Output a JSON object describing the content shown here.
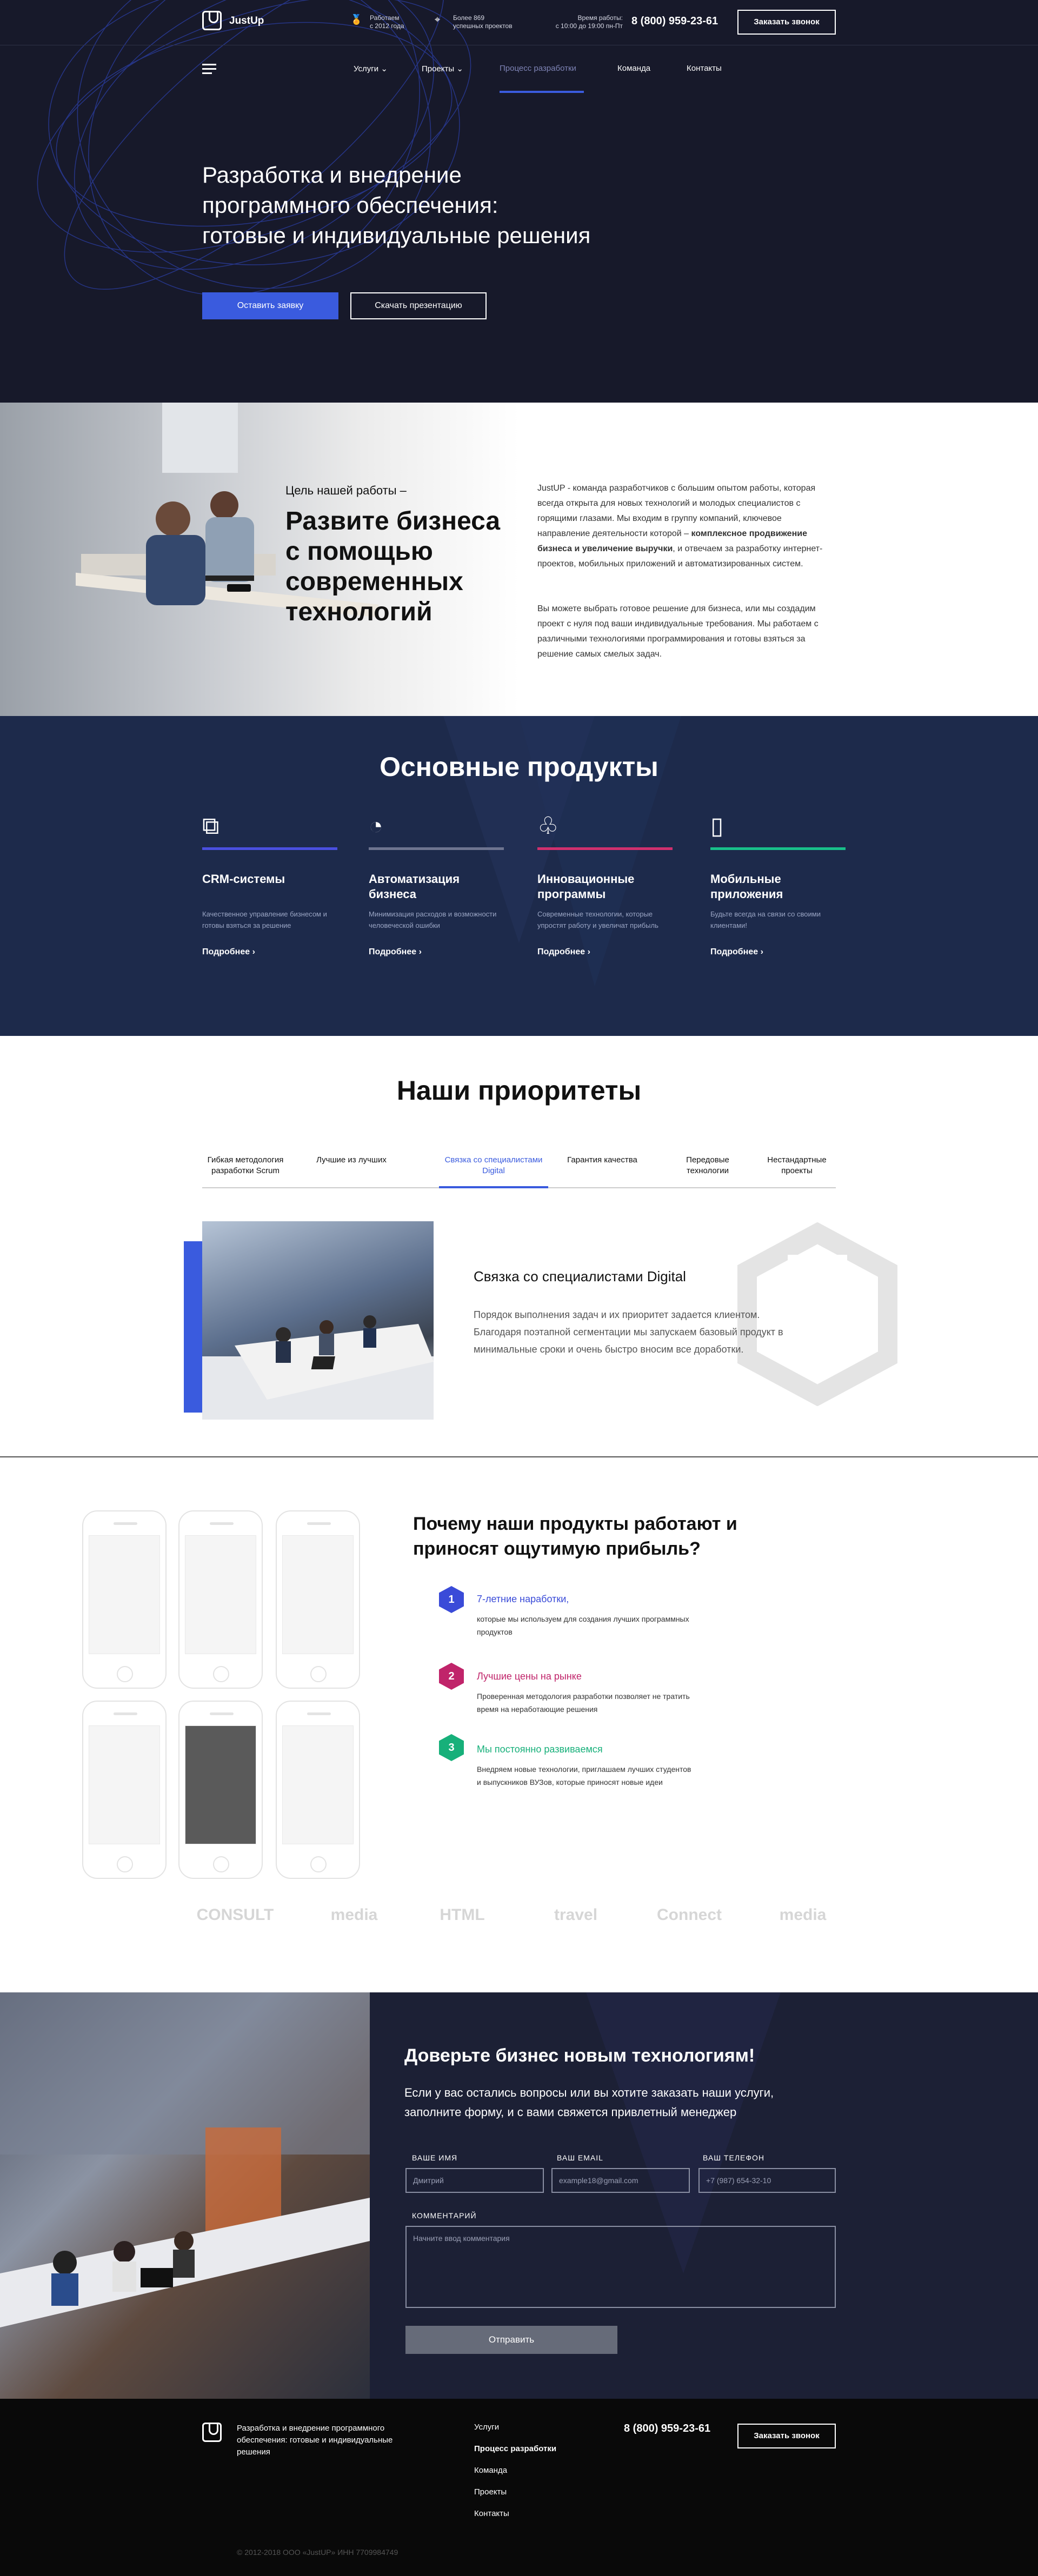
{
  "header": {
    "logo_text": "JustUp",
    "info1_line1": "Работаем",
    "info1_line2": "с 2012 года",
    "info2_line1": "Более 869",
    "info2_line2": "успешных проектов",
    "hours_line1": "Время работы:",
    "hours_line2": "с 10:00 до 19:00 пн-Пт",
    "phone": "8 (800) 959-23-61",
    "callback_button": "Заказать звонок"
  },
  "nav": {
    "items": [
      "Услуги",
      "Проекты",
      "Процесс разработки",
      "Команда",
      "Контакты"
    ],
    "active_index": 2
  },
  "hero": {
    "title_line1": "Разработка и внедрение",
    "title_line2": "программного обеспечения:",
    "title_line3": "готовые и индивидуальные решения",
    "primary_button": "Оставить заявку",
    "secondary_button": "Скачать презентацию"
  },
  "goal": {
    "small_title": "Цель нашей работы –",
    "big_title": "Развите бизнеса с помощью современных технологий",
    "p1_start": "JustUP - команда разработчиков с большим опытом работы, которая всегда открыта для новых технологий и молодых специалистов с горящими глазами. Мы входим в группу компаний, ключевое направление деятельности которой – ",
    "p1_bold": "комплексное продвижение бизнеса и увеличение выручки",
    "p1_end": ", и отвечаем за разработку интернет-проектов, мобильных приложений и автоматизированных систем.",
    "p2": "Вы можете выбрать готовое решение для бизнеса, или мы создадим проект с нуля под ваши индивидуальные требования.  Мы работаем с различными технологиями программирования и готовы взяться за решение самых смелых задач."
  },
  "products": {
    "title": "Основные продукты",
    "items": [
      {
        "icon": "puzzle-icon",
        "title": "CRM-системы",
        "desc": "Качественное управление бизнесом и готовы взяться за решение",
        "more": "Подробнее",
        "color": "#4a4fe0"
      },
      {
        "icon": "gauge-icon",
        "title": "Автоматизация бизнеса",
        "desc": "Минимизация расходов и возможности человеческой ошибки",
        "more": "Подробнее",
        "color": "#6e7590"
      },
      {
        "icon": "tree-icon",
        "title": "Инновационные программы",
        "desc": "Современные технологии, которые упростят работу и увеличат прибыль",
        "more": "Подробнее",
        "color": "#d0306e"
      },
      {
        "icon": "mobile-gear-icon",
        "title": "Мобильные приложения",
        "desc": "Будьте всегда на связи со своими клиентами!",
        "more": "Подробнее",
        "color": "#18c08a"
      }
    ]
  },
  "priorities": {
    "title": "Наши приоритеты",
    "tabs": [
      "Гибкая методология разработки Scrum",
      "Лучшие из лучших",
      "Связка со специалистами Digital",
      "Гарантия качества",
      "Передовые технологии",
      "Нестандартные проекты"
    ],
    "active_tab": 2,
    "content_title": "Связка со специалистами Digital",
    "content_text": "Порядок выполнения задач и их приоритет задается клиентом. Благодаря поэтапной сегментации мы запускаем базовый продукт в минимальные сроки и очень быстро вносим все доработки."
  },
  "why": {
    "title": "Почему наши продукты работают и приносят ощутимую прибыль?",
    "items": [
      {
        "num": "1",
        "title": "7-летние наработки,",
        "desc": "которые мы используем для создания лучших программных продуктов",
        "color": "#3a4bd8"
      },
      {
        "num": "2",
        "title": "Лучшие цены на рынке",
        "desc": "Проверенная методология разработки позволяет не тратить время на неработающие решения",
        "color": "#c0246a"
      },
      {
        "num": "3",
        "title": "Мы постоянно развиваемся",
        "desc": "Внедряем новые технологии, приглашаем лучших студентов и выпускников ВУЗов, которые приносят новые идеи",
        "color": "#17b07a"
      }
    ],
    "partners": [
      "CONSULT",
      "media",
      "HTML",
      "travel",
      "Connect",
      "media"
    ]
  },
  "contact": {
    "title": "Доверьте бизнес новым технологиям!",
    "subtitle": "Если у вас остались вопросы или вы хотите заказать наши услуги, заполните форму, и с вами свяжется привлетный менеджер",
    "name_label": "ВАШЕ ИМЯ",
    "name_placeholder": "Дмитрий",
    "email_label": "ВАШ EMAIL",
    "email_placeholder": "example18@gmail.com",
    "phone_label": "ВАШ ТЕЛЕФОН",
    "phone_placeholder": "+7 (987) 654-32-10",
    "comment_label": "КОММЕНТАРИЙ",
    "comment_placeholder": "Начните ввод комментария",
    "submit": "Отправить"
  },
  "footer": {
    "desc": "Разработка и внедрение программного обеспечения: готовые и индивидуальные решения",
    "links": [
      "Услуги",
      "Процесс разработки",
      "Команда",
      "Проекты",
      "Контакты"
    ],
    "active_link": 1,
    "phone": "8 (800) 959-23-61",
    "callback_button": "Заказать звонок",
    "copyright": "© 2012-2018 ООО «JustUP» ИНН 7709984749"
  }
}
